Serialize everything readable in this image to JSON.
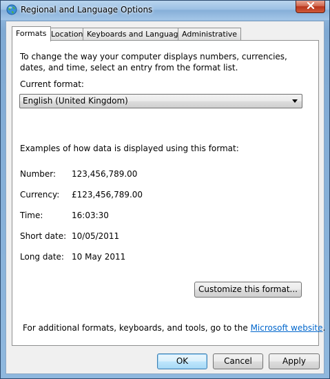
{
  "window": {
    "title": "Regional and Language Options"
  },
  "tabs": [
    {
      "label": "Formats",
      "active": true
    },
    {
      "label": "Location",
      "active": false
    },
    {
      "label": "Keyboards and Languages",
      "active": false
    },
    {
      "label": "Administrative",
      "active": false
    }
  ],
  "formats": {
    "intro": "To change the way your computer displays numbers, currencies, dates, and time, select an entry from the format list.",
    "current_format_label": "Current format:",
    "current_format_value": "English (United Kingdom)",
    "examples_heading": "Examples of how data is displayed using this format:",
    "examples": [
      {
        "label": "Number:",
        "value": "123,456,789.00"
      },
      {
        "label": "Currency:",
        "value": "£123,456,789.00"
      },
      {
        "label": "Time:",
        "value": "16:03:30"
      },
      {
        "label": "Short date:",
        "value": "10/05/2011"
      },
      {
        "label": "Long date:",
        "value": "10 May 2011"
      }
    ],
    "customize_button": "Customize this format...",
    "footer_text_before": "For additional formats, keyboards, and tools, go to the ",
    "footer_link": "Microsoft website",
    "footer_text_after": "."
  },
  "buttons": {
    "ok": "OK",
    "cancel": "Cancel",
    "apply": "Apply"
  },
  "colors": {
    "link": "#0066cc",
    "default_button_border": "#3c7fb1"
  },
  "icons": {
    "title": "globe-icon",
    "close": "close-icon",
    "dropdown": "chevron-down-icon"
  }
}
